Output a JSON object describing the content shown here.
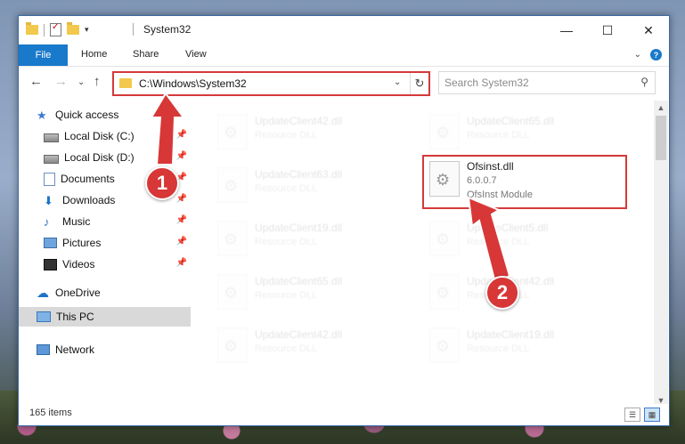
{
  "window": {
    "title": "System32",
    "min_glyph": "—",
    "max_glyph": "☐",
    "close_glyph": "✕"
  },
  "ribbon": {
    "tabs": [
      "File",
      "Home",
      "Share",
      "View"
    ],
    "expand_glyph": "⌄",
    "help_glyph": "?"
  },
  "address": {
    "path": "C:\\Windows\\System32",
    "search_placeholder": "Search System32"
  },
  "nav": {
    "back_glyph": "←",
    "forward_glyph": "→",
    "recent_glyph": "⌄",
    "up_glyph": "↑",
    "items": [
      {
        "label": "Quick access",
        "icon": "quick-access-icon",
        "pinned": false
      },
      {
        "label": "Local Disk (C:)",
        "icon": "local-disk-icon",
        "pinned": true
      },
      {
        "label": "Local Disk (D:)",
        "icon": "local-disk-icon",
        "pinned": true
      },
      {
        "label": "Documents",
        "icon": "documents-icon",
        "pinned": true
      },
      {
        "label": "Downloads",
        "icon": "downloads-icon",
        "pinned": true
      },
      {
        "label": "Music",
        "icon": "music-icon",
        "pinned": true
      },
      {
        "label": "Pictures",
        "icon": "pictures-icon",
        "pinned": true
      },
      {
        "label": "Videos",
        "icon": "videos-icon",
        "pinned": true
      },
      {
        "label": "OneDrive",
        "icon": "onedrive-icon",
        "pinned": false
      },
      {
        "label": "This PC",
        "icon": "this-pc-icon",
        "pinned": false
      },
      {
        "label": "Network",
        "icon": "network-icon",
        "pinned": false
      }
    ]
  },
  "files": [
    {
      "name": "UpdateClient42.dll",
      "desc": "Resource DLL"
    },
    {
      "name": "UpdateClient65.dll",
      "desc": "Resource DLL"
    },
    {
      "name": "UpdateClient63.dll",
      "desc": "Resource DLL"
    },
    {
      "name": "Ofsinst.dll",
      "version": "6.0.0.7",
      "desc": "OfsInst Module"
    },
    {
      "name": "UpdateClient19.dll",
      "desc": "Resource DLL"
    },
    {
      "name": "UpdateClient5.dll",
      "desc": "Resource DLL"
    },
    {
      "name": "UpdateClient65.dll",
      "desc": "Resource DLL"
    },
    {
      "name": "UpdateClient42.dll",
      "desc": "Resource DLL"
    },
    {
      "name": "UpdateClient42.dll",
      "desc": "Resource DLL"
    },
    {
      "name": "UpdateClient19.dll",
      "desc": "Resource DLL"
    }
  ],
  "status": {
    "count": "165 items"
  },
  "annotations": {
    "step1": "1",
    "step2": "2",
    "color": "#d73737"
  }
}
